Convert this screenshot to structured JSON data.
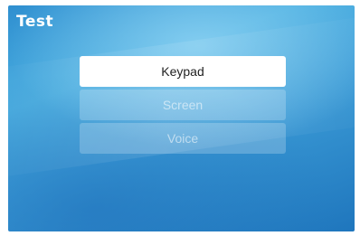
{
  "header": {
    "title": "Test"
  },
  "menu": {
    "items": [
      {
        "label": "Keypad",
        "selected": true
      },
      {
        "label": "Screen",
        "selected": false
      },
      {
        "label": "Voice",
        "selected": false
      }
    ]
  },
  "colors": {
    "background_accent": "#3b9bd6",
    "selected_item_bg": "#ffffff",
    "selected_item_text": "#222222",
    "unselected_item_text": "#a8d6f0"
  }
}
